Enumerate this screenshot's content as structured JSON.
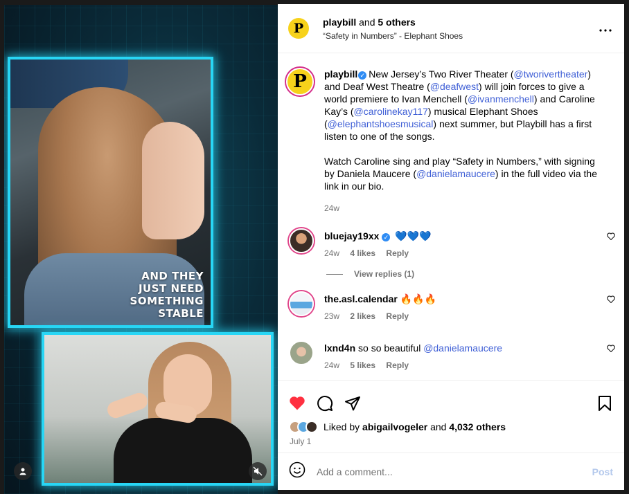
{
  "media": {
    "caption": [
      "AND THEY",
      "JUST NEED",
      "SOMETHING",
      "STABLE"
    ]
  },
  "header": {
    "user": "playbill",
    "and_text": "and",
    "others": "5 others",
    "subtitle": "“Safety in Numbers” - Elephant Shoes",
    "avatar_letter": "P"
  },
  "post": {
    "user": "playbill",
    "avatar_letter": "P",
    "segments": [
      {
        "t": "New Jersey’s Two River Theater ("
      },
      {
        "t": "@tworivertheater",
        "link": true
      },
      {
        "t": ") and Deaf West Theatre ("
      },
      {
        "t": "@deafwest",
        "link": true
      },
      {
        "t": ") will join forces to give a world premiere to Ivan Menchell ("
      },
      {
        "t": "@ivanmenchell",
        "link": true
      },
      {
        "t": ") and Caroline Kay’s ("
      },
      {
        "t": "@carolinekay117",
        "link": true
      },
      {
        "t": ") musical Elephant Shoes ("
      },
      {
        "t": "@elephantshoesmusical",
        "link": true
      },
      {
        "t": ") next summer, but Playbill has a first listen to one of the songs."
      }
    ],
    "segments2": [
      {
        "t": "Watch Caroline sing and play “Safety in Numbers,” with signing by Daniela Maucere ("
      },
      {
        "t": "@danielamaucere",
        "link": true
      },
      {
        "t": ") in the full video via the link in our bio."
      }
    ],
    "time": "24w"
  },
  "comments": [
    {
      "user": "bluejay19xx",
      "verified": true,
      "text": "💙💙💙",
      "time": "24w",
      "likes": "4 likes",
      "reply": "Reply",
      "avatar_color": "#3a2d26"
    },
    {
      "user": "the.asl.calendar",
      "verified": false,
      "text": "🔥🔥🔥",
      "time": "23w",
      "likes": "2 likes",
      "reply": "Reply",
      "avatar_color": "#5aa7e0"
    },
    {
      "user": "lxnd4n",
      "verified": false,
      "text": "so so beautiful ",
      "mention": "@danielamaucere",
      "time": "24w",
      "likes": "5 likes",
      "reply": "Reply",
      "avatar_color": "#9aa48a"
    }
  ],
  "view_replies": "View replies (1)",
  "likes": {
    "prefix": "Liked by",
    "user": "abigailvogeler",
    "and": "and",
    "others": "4,032 others",
    "date": "July 1"
  },
  "add_comment": {
    "placeholder": "Add a comment...",
    "post_label": "Post"
  },
  "colors": {
    "accent_link": "#3f5fd6",
    "heart_red": "#ff3040",
    "glow": "#28d6f5"
  }
}
